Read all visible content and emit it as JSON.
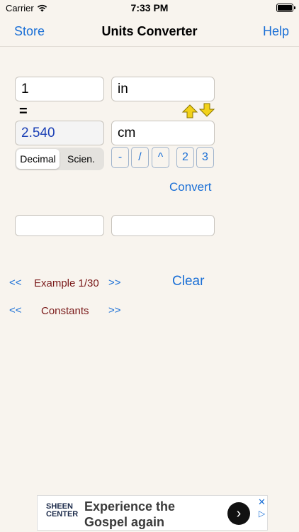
{
  "status_bar": {
    "carrier": "Carrier",
    "time": "7:33 PM"
  },
  "nav": {
    "left": "Store",
    "title": "Units Converter",
    "right": "Help"
  },
  "converter": {
    "input_value": "1",
    "input_unit": "in",
    "equals": "=",
    "result_value": "2.540",
    "result_unit": "cm",
    "format_options": [
      "Decimal",
      "Scien."
    ],
    "selected_format": "Decimal",
    "unit_keys": [
      "-",
      "/",
      "^",
      "2",
      "3"
    ],
    "convert_label": "Convert",
    "extra_field_1": "",
    "extra_field_2": ""
  },
  "examples": {
    "prev": "<<",
    "label": "Example 1/30",
    "next": ">>",
    "clear": "Clear"
  },
  "constants": {
    "prev": "<<",
    "label": "Constants",
    "next": ">>"
  },
  "ad": {
    "logo_line1": "SHEEN",
    "logo_line2": "CENTER",
    "headline_1": "Experience the",
    "headline_2": "Gospel again",
    "arrow": "›",
    "close": "✕",
    "choice": "▷"
  },
  "colors": {
    "accent": "#1a6fd6",
    "maroon": "#7a1a1a",
    "background": "#f8f4ee",
    "result_text": "#1a3fb5"
  }
}
